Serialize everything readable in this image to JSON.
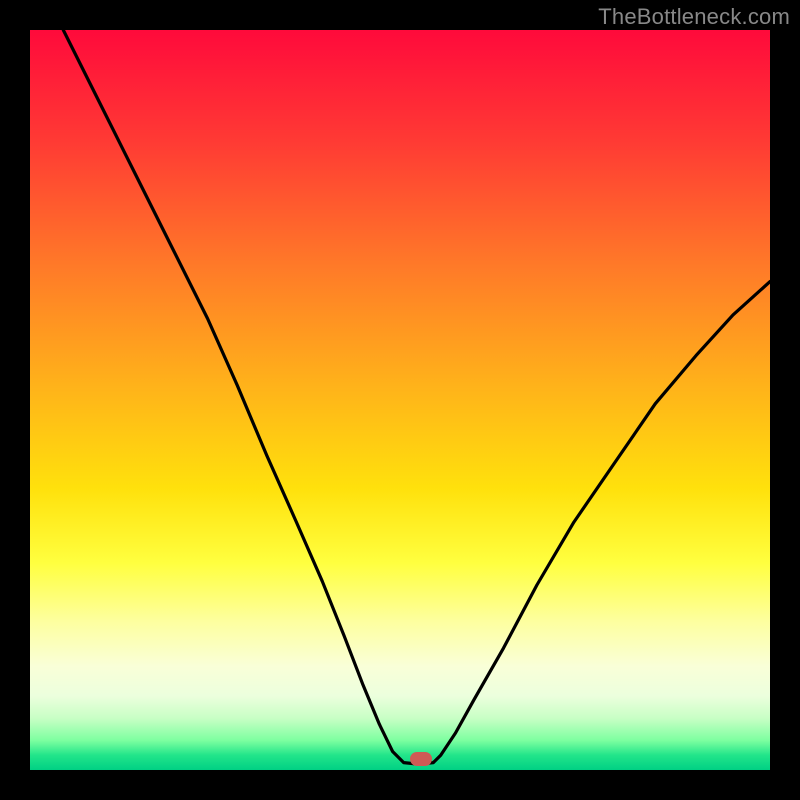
{
  "watermark": "TheBottleneck.com",
  "marker": {
    "x_frac": 0.528,
    "y_frac": 0.985
  },
  "chart_data": {
    "type": "line",
    "title": "",
    "xlabel": "",
    "ylabel": "",
    "xlim": [
      0,
      1
    ],
    "ylim": [
      0,
      1
    ],
    "series": [
      {
        "name": "bottleneck-curve",
        "points": [
          {
            "x": 0.045,
            "y": 1.0
          },
          {
            "x": 0.09,
            "y": 0.91
          },
          {
            "x": 0.14,
            "y": 0.81
          },
          {
            "x": 0.19,
            "y": 0.71
          },
          {
            "x": 0.24,
            "y": 0.61
          },
          {
            "x": 0.28,
            "y": 0.52
          },
          {
            "x": 0.32,
            "y": 0.425
          },
          {
            "x": 0.36,
            "y": 0.335
          },
          {
            "x": 0.395,
            "y": 0.255
          },
          {
            "x": 0.425,
            "y": 0.18
          },
          {
            "x": 0.45,
            "y": 0.115
          },
          {
            "x": 0.472,
            "y": 0.062
          },
          {
            "x": 0.49,
            "y": 0.025
          },
          {
            "x": 0.505,
            "y": 0.01
          },
          {
            "x": 0.525,
            "y": 0.008
          },
          {
            "x": 0.545,
            "y": 0.01
          },
          {
            "x": 0.555,
            "y": 0.02
          },
          {
            "x": 0.575,
            "y": 0.05
          },
          {
            "x": 0.6,
            "y": 0.095
          },
          {
            "x": 0.64,
            "y": 0.165
          },
          {
            "x": 0.685,
            "y": 0.25
          },
          {
            "x": 0.735,
            "y": 0.335
          },
          {
            "x": 0.79,
            "y": 0.415
          },
          {
            "x": 0.845,
            "y": 0.495
          },
          {
            "x": 0.9,
            "y": 0.56
          },
          {
            "x": 0.95,
            "y": 0.615
          },
          {
            "x": 1.0,
            "y": 0.66
          }
        ]
      }
    ],
    "gradient_note": "background vertical gradient from red (top) through orange/yellow to green (bottom)"
  }
}
